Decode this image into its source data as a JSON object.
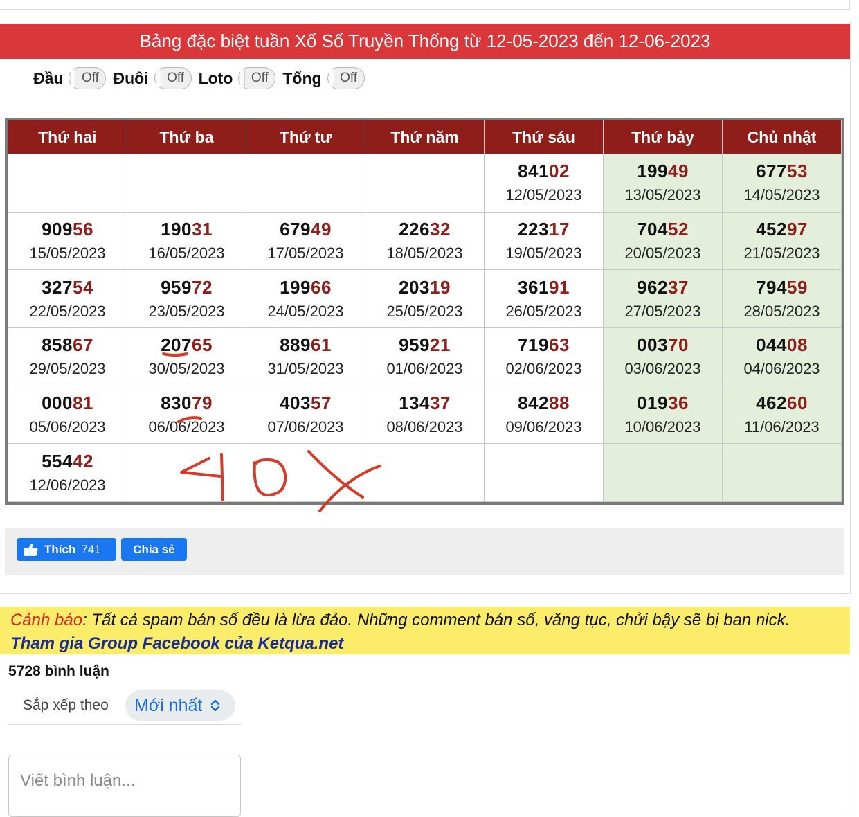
{
  "title": "Bảng đặc biệt tuần Xổ Số Truyền Thống từ 12-05-2023 đến 12-06-2023",
  "toggles": [
    {
      "label": "Đầu",
      "state": "Off"
    },
    {
      "label": "Đuôi",
      "state": "Off"
    },
    {
      "label": "Loto",
      "state": "Off"
    },
    {
      "label": "Tổng",
      "state": "Off"
    }
  ],
  "table": {
    "headers": [
      "Thứ hai",
      "Thứ ba",
      "Thứ tư",
      "Thứ năm",
      "Thứ sáu",
      "Thứ bảy",
      "Chủ nhật"
    ],
    "rows": [
      [
        null,
        null,
        null,
        null,
        {
          "head": "841",
          "tail": "02",
          "date": "12/05/2023"
        },
        {
          "head": "199",
          "tail": "49",
          "date": "13/05/2023"
        },
        {
          "head": "677",
          "tail": "53",
          "date": "14/05/2023"
        }
      ],
      [
        {
          "head": "909",
          "tail": "56",
          "date": "15/05/2023"
        },
        {
          "head": "190",
          "tail": "31",
          "date": "16/05/2023"
        },
        {
          "head": "679",
          "tail": "49",
          "date": "17/05/2023"
        },
        {
          "head": "226",
          "tail": "32",
          "date": "18/05/2023"
        },
        {
          "head": "223",
          "tail": "17",
          "date": "19/05/2023"
        },
        {
          "head": "704",
          "tail": "52",
          "date": "20/05/2023"
        },
        {
          "head": "452",
          "tail": "97",
          "date": "21/05/2023"
        }
      ],
      [
        {
          "head": "327",
          "tail": "54",
          "date": "22/05/2023"
        },
        {
          "head": "959",
          "tail": "72",
          "date": "23/05/2023"
        },
        {
          "head": "199",
          "tail": "66",
          "date": "24/05/2023"
        },
        {
          "head": "203",
          "tail": "19",
          "date": "25/05/2023"
        },
        {
          "head": "361",
          "tail": "91",
          "date": "26/05/2023"
        },
        {
          "head": "962",
          "tail": "37",
          "date": "27/05/2023"
        },
        {
          "head": "794",
          "tail": "59",
          "date": "28/05/2023"
        }
      ],
      [
        {
          "head": "858",
          "tail": "67",
          "date": "29/05/2023"
        },
        {
          "head": "207",
          "tail": "65",
          "date": "30/05/2023"
        },
        {
          "head": "889",
          "tail": "61",
          "date": "31/05/2023"
        },
        {
          "head": "959",
          "tail": "21",
          "date": "01/06/2023"
        },
        {
          "head": "719",
          "tail": "63",
          "date": "02/06/2023"
        },
        {
          "head": "003",
          "tail": "70",
          "date": "03/06/2023"
        },
        {
          "head": "044",
          "tail": "08",
          "date": "04/06/2023"
        }
      ],
      [
        {
          "head": "000",
          "tail": "81",
          "date": "05/06/2023"
        },
        {
          "head": "830",
          "tail": "79",
          "date": "06/06/2023"
        },
        {
          "head": "403",
          "tail": "57",
          "date": "07/06/2023"
        },
        {
          "head": "134",
          "tail": "37",
          "date": "08/06/2023"
        },
        {
          "head": "842",
          "tail": "88",
          "date": "09/06/2023"
        },
        {
          "head": "019",
          "tail": "36",
          "date": "10/06/2023"
        },
        {
          "head": "462",
          "tail": "60",
          "date": "11/06/2023"
        }
      ],
      [
        {
          "head": "554",
          "tail": "42",
          "date": "12/06/2023"
        },
        null,
        null,
        null,
        null,
        null,
        null
      ]
    ]
  },
  "handwriting": "40X",
  "share": {
    "like_label": "Thích",
    "like_count": "741",
    "share_label": "Chia sẻ"
  },
  "warning": {
    "prefix": "Cảnh báo",
    "text": ": Tất cả spam bán số đều là lừa đảo. Những comment bán số, văng tục, chửi bậy sẽ bị ban nick.",
    "group_link": "Tham gia Group Facebook của Ketqua.net"
  },
  "comments": {
    "count_label": "5728 bình luận",
    "sort_label": "Sắp xếp theo",
    "sort_value": "Mới nhất",
    "placeholder": "Viết bình luận..."
  },
  "colors": {
    "title_bg": "#d9373a",
    "header_bg": "#8f1d19",
    "tail_color": "#8f1d19",
    "weekend_bg": "#e3efda",
    "fb_blue": "#1a77f2",
    "warning_bg": "#fbec6a",
    "annotation": "#d83a2a"
  }
}
